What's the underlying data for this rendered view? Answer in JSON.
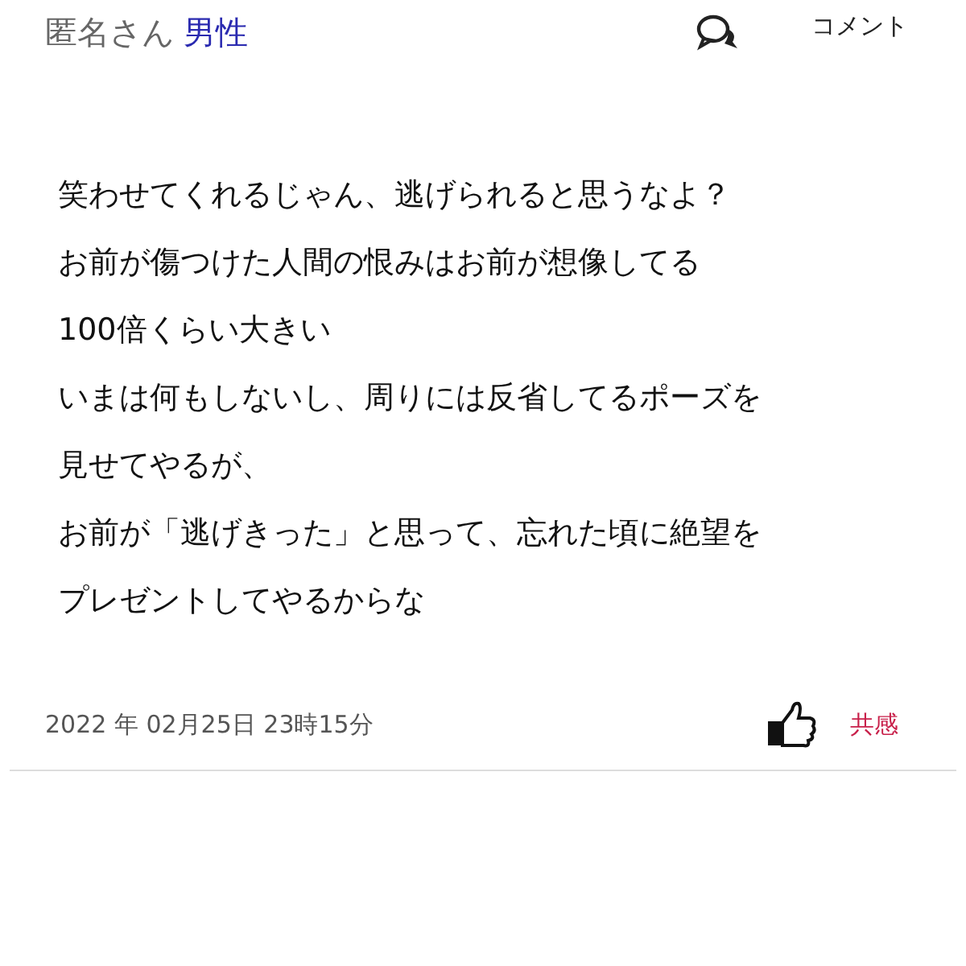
{
  "post": {
    "author": "匿名さん",
    "gender": "男性",
    "comment_label": "コメント",
    "lines": [
      "笑わせてくれるじゃん、逃げられると思うなよ？",
      "お前が傷つけた人間の恨みはお前が想像してる",
      "100倍くらい大きい",
      "いまは何もしないし、周りには反省してるポーズを",
      "見せてやるが、",
      "お前が「逃げきった」と思って、忘れた頃に絶望を",
      "プレゼントしてやるからな"
    ],
    "date": "2022 年 02月25日 23時15分",
    "like_label": "共感"
  }
}
